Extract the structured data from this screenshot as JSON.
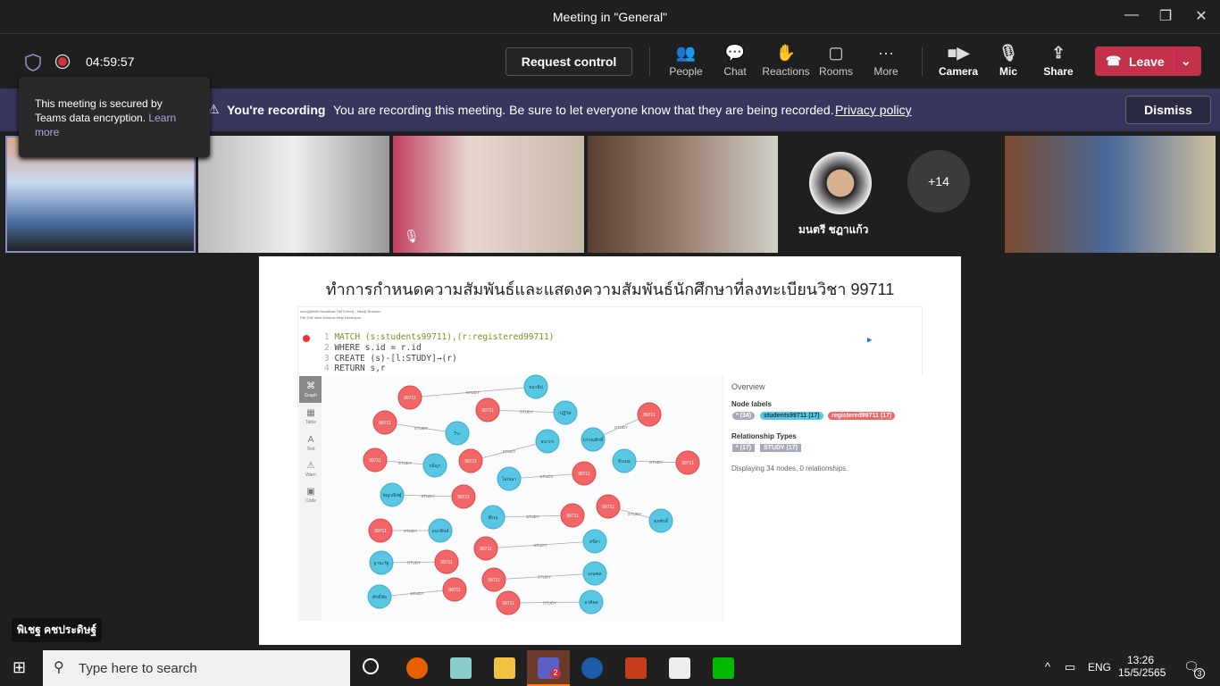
{
  "window": {
    "title": "Meeting in \"General\"",
    "min": "—",
    "max": "❐",
    "close": "✕"
  },
  "toolbar": {
    "timer": "04:59:57",
    "request_control": "Request control",
    "people": "People",
    "chat": "Chat",
    "reactions": "Reactions",
    "rooms": "Rooms",
    "more": "More",
    "camera": "Camera",
    "mic": "Mic",
    "share": "Share",
    "leave": "Leave"
  },
  "tooltip": {
    "text": "This meeting is secured by Teams data encryption.",
    "link": "Learn more"
  },
  "banner": {
    "title": "You're recording",
    "message": "You are recording this meeting. Be sure to let everyone know that they are being recorded.",
    "link": "Privacy policy",
    "dismiss": "Dismiss"
  },
  "participants": {
    "named": "มนตรี ชฎาแก้ว",
    "overflow": "+14",
    "presenter": "พิเชฐ คชประดิษฐ์"
  },
  "slide": {
    "title": "ทำการกำหนดความสัมพันธ์และแสดงความสัมพันธ์นักศึกษาที่ลงทะเบียนวิชา 99711",
    "browser_title": "neo4j@bolt://localhost:7687/neo4j - Neo4j Browser",
    "menu": "File  Edit  View  Window  Help  Developer",
    "code": [
      "MATCH (s:students99711),(r:registered99711)",
      "WHERE s.id = r.id",
      "CREATE (s)-[l:STUDY]→(r)",
      "RETURN s,r"
    ],
    "side_tabs": [
      "Graph",
      "Table",
      "Text",
      "Warn",
      "Code"
    ],
    "overview": {
      "title": "Overview",
      "node_labels_heading": "Node labels",
      "node_labels": [
        "* (34)",
        "students99711 (17)",
        "registered99711 (17)"
      ],
      "rel_heading": "Relationship Types",
      "rels": [
        "* (17)",
        "STUDY (17)"
      ],
      "status": "Displaying 34 nodes, 0 relationships."
    },
    "rel_label": "STUDY",
    "course_label": "99711",
    "students": [
      "ธนาธิป",
      "ปฏิวิส",
      "วีระ",
      "ธนากร",
      "บรรณศักดิ์",
      "กล้ญา",
      "ธีรเมธ",
      "โสภณา",
      "ชญาณิชฐ์",
      "พีรณุ",
      "ศุภศักดิ์",
      "อนาคินธ์",
      "ศรีดา",
      "ฐานะรัฐ",
      "มณฑล",
      "ศักดิ์ชัย",
      "อาทิตย"
    ],
    "colors": {
      "student": "#57c7e3",
      "registered": "#f16667"
    }
  },
  "taskbar": {
    "search": "Type here to search",
    "lang": "ENG",
    "time": "13:26",
    "date": "15/5/2565",
    "notif": "3",
    "teams_badge": "2"
  }
}
